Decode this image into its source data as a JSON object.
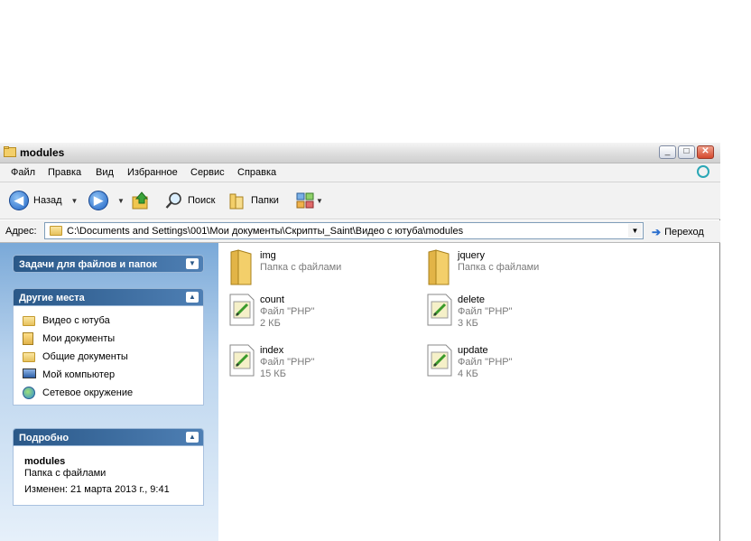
{
  "window": {
    "title": "modules"
  },
  "menu": [
    "Файл",
    "Правка",
    "Вид",
    "Избранное",
    "Сервис",
    "Справка"
  ],
  "toolbar": {
    "back_label": "Назад",
    "search_label": "Поиск",
    "folders_label": "Папки"
  },
  "address": {
    "label": "Адрес:",
    "value": "C:\\Documents and Settings\\001\\Мои документы\\Скрипты_Saint\\Видео с ютуба\\modules",
    "go_label": "Переход"
  },
  "sidebar": {
    "tasks_title": "Задачи для файлов и папок",
    "places_title": "Другие места",
    "places": [
      {
        "label": "Видео с ютуба",
        "icon": "folder-icon"
      },
      {
        "label": "Мои документы",
        "icon": "my-documents-icon"
      },
      {
        "label": "Общие документы",
        "icon": "folder-icon"
      },
      {
        "label": "Мой компьютер",
        "icon": "computer-icon"
      },
      {
        "label": "Сетевое окружение",
        "icon": "network-icon"
      }
    ],
    "details_title": "Подробно",
    "details": {
      "name": "modules",
      "type": "Папка с файлами",
      "modified": "Изменен: 21 марта 2013 г., 9:41"
    }
  },
  "files": [
    {
      "name": "img",
      "type": "Папка с файлами",
      "size": "",
      "icon": "folder-icon"
    },
    {
      "name": "jquery",
      "type": "Папка с файлами",
      "size": "",
      "icon": "folder-icon"
    },
    {
      "name": "count",
      "type": "Файл \"PHP\"",
      "size": "2 КБ",
      "icon": "php-file-icon"
    },
    {
      "name": "delete",
      "type": "Файл \"PHP\"",
      "size": "3 КБ",
      "icon": "php-file-icon"
    },
    {
      "name": "index",
      "type": "Файл \"PHP\"",
      "size": "15 КБ",
      "icon": "php-file-icon"
    },
    {
      "name": "update",
      "type": "Файл \"PHP\"",
      "size": "4 КБ",
      "icon": "php-file-icon"
    }
  ]
}
